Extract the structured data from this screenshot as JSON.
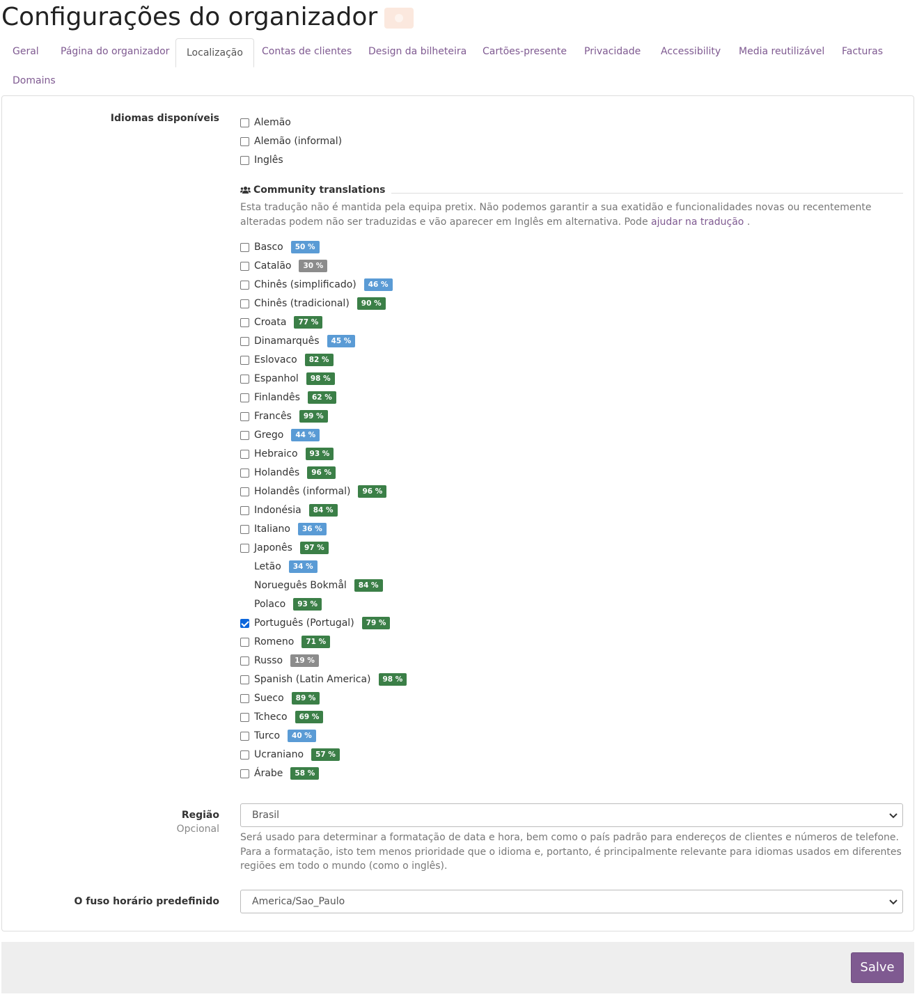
{
  "header": {
    "title": "Configurações do organizador"
  },
  "tabs": [
    {
      "label": "Geral"
    },
    {
      "label": "Página do organizador"
    },
    {
      "label": "Localização",
      "active": true
    },
    {
      "label": "Contas de clientes"
    },
    {
      "label": "Design da bilheteira"
    },
    {
      "label": "Cartões-presente"
    },
    {
      "label": "Privacidade"
    },
    {
      "label": "Accessibility"
    },
    {
      "label": "Media reutilizável"
    },
    {
      "label": "Facturas"
    },
    {
      "label": "Domains"
    }
  ],
  "languages": {
    "label": "Idiomas disponíveis",
    "official": [
      {
        "name": "Alemão",
        "checked": false
      },
      {
        "name": "Alemão (informal)",
        "checked": false
      },
      {
        "name": "Inglês",
        "checked": false
      }
    ],
    "community": {
      "title": "Community translations",
      "icon": "users-icon",
      "help_before": "Esta tradução não é mantida pela equipa pretix. Não podemos garantir a sua exatidão e funcionalidades novas ou recentemente alteradas podem não ser traduzidas e vão aparecer em Inglês em alternativa. Pode",
      "help_link": "ajudar na tradução",
      "help_after": ".",
      "items": [
        {
          "name": "Basco",
          "badge": "50 %",
          "checked": false,
          "checkbox": true,
          "color": "#5a9bd5"
        },
        {
          "name": "Catalão",
          "badge": "30 %",
          "checked": false,
          "checkbox": true,
          "color": "#8c8c8c"
        },
        {
          "name": "Chinês (simplificado)",
          "badge": "46 %",
          "checked": false,
          "checkbox": true,
          "color": "#5a9bd5"
        },
        {
          "name": "Chinês (tradicional)",
          "badge": "90 %",
          "checked": false,
          "checkbox": true,
          "color": "#3b7f47"
        },
        {
          "name": "Croata",
          "badge": "77 %",
          "checked": false,
          "checkbox": true,
          "color": "#3b7f47"
        },
        {
          "name": "Dinamarquês",
          "badge": "45 %",
          "checked": false,
          "checkbox": true,
          "color": "#5a9bd5"
        },
        {
          "name": "Eslovaco",
          "badge": "82 %",
          "checked": false,
          "checkbox": true,
          "color": "#3b7f47"
        },
        {
          "name": "Espanhol",
          "badge": "98 %",
          "checked": false,
          "checkbox": true,
          "color": "#3b7f47"
        },
        {
          "name": "Finlandês",
          "badge": "62 %",
          "checked": false,
          "checkbox": true,
          "color": "#3b7f47"
        },
        {
          "name": "Francês",
          "badge": "99 %",
          "checked": false,
          "checkbox": true,
          "color": "#3b7f47"
        },
        {
          "name": "Grego",
          "badge": "44 %",
          "checked": false,
          "checkbox": true,
          "color": "#5a9bd5"
        },
        {
          "name": "Hebraico",
          "badge": "93 %",
          "checked": false,
          "checkbox": true,
          "color": "#3b7f47"
        },
        {
          "name": "Holandês",
          "badge": "96 %",
          "checked": false,
          "checkbox": true,
          "color": "#3b7f47"
        },
        {
          "name": "Holandês (informal)",
          "badge": "96 %",
          "checked": false,
          "checkbox": true,
          "color": "#3b7f47"
        },
        {
          "name": "Indonésia",
          "badge": "84 %",
          "checked": false,
          "checkbox": true,
          "color": "#3b7f47"
        },
        {
          "name": "Italiano",
          "badge": "36 %",
          "checked": false,
          "checkbox": true,
          "color": "#5a9bd5"
        },
        {
          "name": "Japonês",
          "badge": "97 %",
          "checked": false,
          "checkbox": true,
          "color": "#3b7f47"
        },
        {
          "name": "Letão",
          "badge": "34 %",
          "checked": false,
          "checkbox": false,
          "color": "#5a9bd5"
        },
        {
          "name": "Norueguês Bokmål",
          "badge": "84 %",
          "checked": false,
          "checkbox": false,
          "color": "#3b7f47"
        },
        {
          "name": "Polaco",
          "badge": "93 %",
          "checked": false,
          "checkbox": false,
          "color": "#3b7f47"
        },
        {
          "name": "Português (Portugal)",
          "badge": "79 %",
          "checked": true,
          "checkbox": true,
          "color": "#3b7f47"
        },
        {
          "name": "Romeno",
          "badge": "71 %",
          "checked": false,
          "checkbox": true,
          "color": "#3b7f47"
        },
        {
          "name": "Russo",
          "badge": "19 %",
          "checked": false,
          "checkbox": true,
          "color": "#8c8c8c"
        },
        {
          "name": "Spanish (Latin America)",
          "badge": "98 %",
          "checked": false,
          "checkbox": true,
          "color": "#3b7f47"
        },
        {
          "name": "Sueco",
          "badge": "89 %",
          "checked": false,
          "checkbox": true,
          "color": "#3b7f47"
        },
        {
          "name": "Tcheco",
          "badge": "69 %",
          "checked": false,
          "checkbox": true,
          "color": "#3b7f47"
        },
        {
          "name": "Turco",
          "badge": "40 %",
          "checked": false,
          "checkbox": true,
          "color": "#5a9bd5"
        },
        {
          "name": "Ucraniano",
          "badge": "57 %",
          "checked": false,
          "checkbox": true,
          "color": "#3b7f47"
        },
        {
          "name": "Árabe",
          "badge": "58 %",
          "checked": false,
          "checkbox": true,
          "color": "#3b7f47"
        }
      ]
    }
  },
  "region": {
    "label": "Região",
    "optional": "Opcional",
    "value": "Brasil",
    "help": "Será usado para determinar a formatação de data e hora, bem como o país padrão para endereços de clientes e números de telefone. Para a formatação, isto tem menos prioridade que o idioma e, portanto, é principalmente relevante para idiomas usados em diferentes regiões em todo o mundo (como o inglês)."
  },
  "timezone": {
    "label": "O fuso horário predefinido",
    "value": "America/Sao_Paulo"
  },
  "footer": {
    "save_label": "Salve"
  },
  "colors": {
    "accent": "#7f5a91",
    "badge_green": "#3b7f47",
    "badge_blue": "#5a9bd5",
    "badge_gray": "#8c8c8c"
  }
}
